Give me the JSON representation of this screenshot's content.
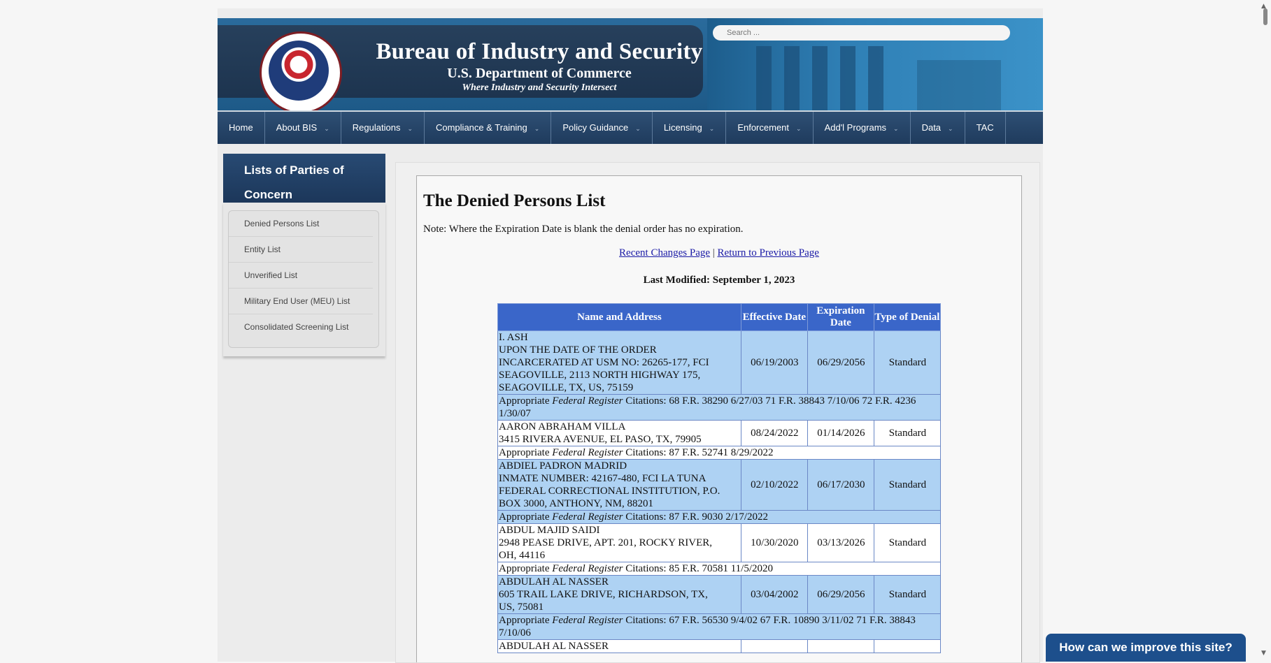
{
  "header": {
    "title": "Bureau of Industry and Security",
    "subtitle": "U.S. Department of Commerce",
    "tagline": "Where Industry and Security Intersect",
    "seal_text": "U.S. DEPARTMENT OF COMMERCE · BUREAU OF INDUSTRY AND SECURITY",
    "search_placeholder": "Search ..."
  },
  "nav": [
    {
      "label": "Home",
      "has_dropdown": false
    },
    {
      "label": "About BIS",
      "has_dropdown": true
    },
    {
      "label": "Regulations",
      "has_dropdown": true
    },
    {
      "label": "Compliance & Training",
      "has_dropdown": true
    },
    {
      "label": "Policy Guidance",
      "has_dropdown": true
    },
    {
      "label": "Licensing",
      "has_dropdown": true
    },
    {
      "label": "Enforcement",
      "has_dropdown": true
    },
    {
      "label": "Add'l Programs",
      "has_dropdown": true
    },
    {
      "label": "Data",
      "has_dropdown": true
    },
    {
      "label": "TAC",
      "has_dropdown": false
    }
  ],
  "sidebar": {
    "heading": "Lists of Parties of Concern",
    "items": [
      {
        "label": "Denied Persons List"
      },
      {
        "label": "Entity List"
      },
      {
        "label": "Unverified List"
      },
      {
        "label": "Military End User (MEU) List"
      },
      {
        "label": "Consolidated Screening List"
      }
    ]
  },
  "main": {
    "page_title": "The Denied Persons List",
    "note": "Note: Where the Expiration Date is blank the denial order has no expiration.",
    "link_recent": "Recent Changes Page",
    "link_separator": "|",
    "link_return": "Return to Previous Page",
    "last_modified": "Last Modified: September 1, 2023",
    "table": {
      "headers": [
        "Name and Address",
        "Effective Date",
        "Expiration Date",
        "Type of Denial"
      ],
      "cite_prefix": "Appropriate ",
      "cite_italic": "Federal Register",
      "cite_label": " Citations: ",
      "rows": [
        {
          "name_lines": [
            "I. ASH",
            "UPON THE DATE OF THE ORDER",
            "INCARCERATED AT USM NO: 26265-177, FCI",
            "SEAGOVILLE, 2113 NORTH HIGHWAY 175,",
            "SEAGOVILLE, TX, US, 75159"
          ],
          "effective": "06/19/2003",
          "expiration": "06/29/2056",
          "type": "Standard",
          "citation": "68 F.R. 38290 6/27/03 71 F.R. 38843 7/10/06 72 F.R. 4236 1/30/07",
          "row_color": "blue",
          "cite_color": "blue"
        },
        {
          "name_lines": [
            "AARON ABRAHAM VILLA",
            "3415 RIVERA AVENUE, EL PASO, TX, 79905"
          ],
          "effective": "08/24/2022",
          "expiration": "01/14/2026",
          "type": "Standard",
          "citation": "87 F.R. 52741 8/29/2022",
          "row_color": "white",
          "cite_color": "white"
        },
        {
          "name_lines": [
            "ABDIEL PADRON MADRID",
            "INMATE NUMBER: 42167-480, FCI LA TUNA",
            "FEDERAL CORRECTIONAL INSTITUTION, P.O.",
            "BOX 3000, ANTHONY, NM, 88201"
          ],
          "effective": "02/10/2022",
          "expiration": "06/17/2030",
          "type": "Standard",
          "citation": "87 F.R. 9030 2/17/2022",
          "row_color": "blue",
          "cite_color": "blue"
        },
        {
          "name_lines": [
            "ABDUL MAJID SAIDI",
            "2948 PEASE DRIVE, APT. 201, ROCKY RIVER,",
            "OH, 44116"
          ],
          "effective": "10/30/2020",
          "expiration": "03/13/2026",
          "type": "Standard",
          "citation": "85 F.R. 70581 11/5/2020",
          "row_color": "white",
          "cite_color": "white"
        },
        {
          "name_lines": [
            "ABDULAH AL NASSER",
            "605 TRAIL LAKE DRIVE, RICHARDSON, TX,",
            "US, 75081"
          ],
          "effective": "03/04/2002",
          "expiration": "06/29/2056",
          "type": "Standard",
          "citation": "67 F.R. 56530 9/4/02 67 F.R. 10890 3/11/02 71 F.R. 38843 7/10/06",
          "row_color": "blue",
          "cite_color": "blue"
        },
        {
          "name_lines": [
            "ABDULAH AL NASSER"
          ],
          "effective": "",
          "expiration": "",
          "type": "",
          "citation": "",
          "row_color": "white",
          "cite_color": "white"
        }
      ]
    }
  },
  "feedback_button": "How can we improve this site?",
  "colors": {
    "nav_bg": "#1f3b5d",
    "table_header": "#3a66c9",
    "row_blue": "#aed2f3",
    "link": "#1a1aa6",
    "feedback_bg": "#1d4f8c"
  }
}
